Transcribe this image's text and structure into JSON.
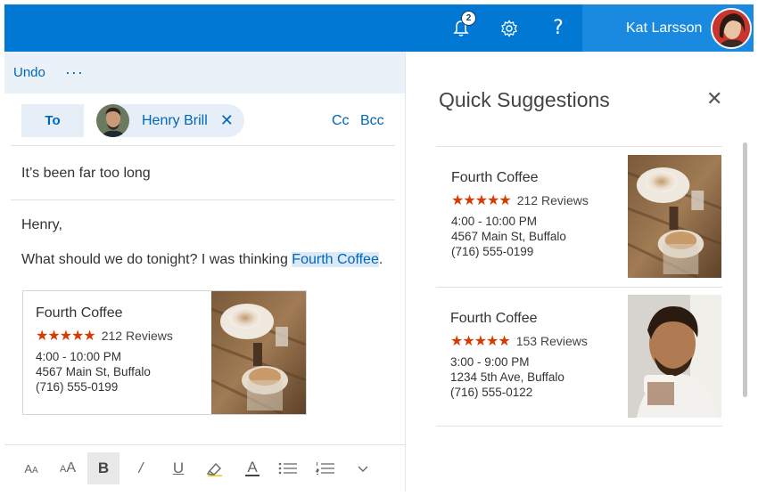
{
  "topbar": {
    "notification_count": "2",
    "help_glyph": "?",
    "user_name": "Kat Larsson",
    "accent": "#0078d4"
  },
  "compose": {
    "undo_label": "Undo",
    "more_label": "···",
    "to_label": "To",
    "recipient": "Henry Brill",
    "remove_glyph": "✕",
    "cc_label": "Cc",
    "bcc_label": "Bcc",
    "subject": "It’s been far too long",
    "greeting": "Henry,",
    "body_prefix": "What should we do tonight?  I was thinking ",
    "body_link": "Fourth Coffee",
    "body_suffix": ".",
    "card": {
      "title": "Fourth Coffee",
      "stars": "★★★★★",
      "reviews": "212 Reviews",
      "hours": "4:00 - 10:00 PM",
      "address": "4567 Main St, Buffalo",
      "phone": "(716) 555-0199"
    },
    "toolbar": [
      "font-size-decrease-icon",
      "font-size-increase-icon",
      "bold-icon",
      "italic-icon",
      "underline-icon",
      "highlighter-icon",
      "font-color-icon",
      "bullets-icon",
      "numbering-icon",
      "chevron-down-icon"
    ],
    "toolbar_glyphs": {
      "small": "A",
      "small2": "A",
      "bold": "B",
      "italic": "/",
      "underline": "U",
      "fontcolor": "A",
      "chevron": "⌄"
    }
  },
  "panel": {
    "title": "Quick Suggestions",
    "close_glyph": "✕",
    "suggestions": [
      {
        "title": "Fourth Coffee",
        "stars": "★★★★★",
        "reviews": "212 Reviews",
        "hours": "4:00 - 10:00 PM",
        "address": "4567 Main St, Buffalo",
        "phone": "(716) 555-0199"
      },
      {
        "title": "Fourth Coffee",
        "stars": "★★★★★",
        "reviews": "153 Reviews",
        "hours": "3:00 - 9:00 PM",
        "address": "1234 5th Ave, Buffalo",
        "phone": "(716) 555-0122"
      }
    ]
  }
}
